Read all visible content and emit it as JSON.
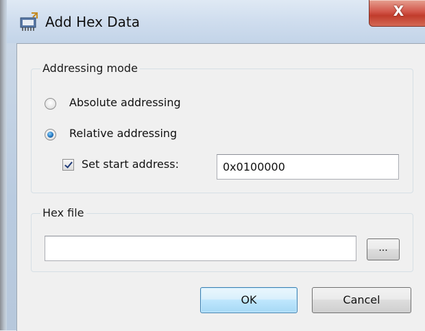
{
  "window": {
    "title": "Add Hex Data",
    "close_label": "X"
  },
  "addressing_group": {
    "label": "Addressing mode",
    "absolute_label": "Absolute addressing",
    "relative_label": "Relative addressing",
    "selected": "relative",
    "set_start_label": "Set start address:",
    "set_start_checked": true,
    "start_address_value": "0x0100000"
  },
  "hex_group": {
    "label": "Hex file",
    "file_value": "",
    "browse_label": "..."
  },
  "buttons": {
    "ok_label": "OK",
    "cancel_label": "Cancel"
  },
  "icons": {
    "app": "chip-icon",
    "close": "close-icon"
  }
}
